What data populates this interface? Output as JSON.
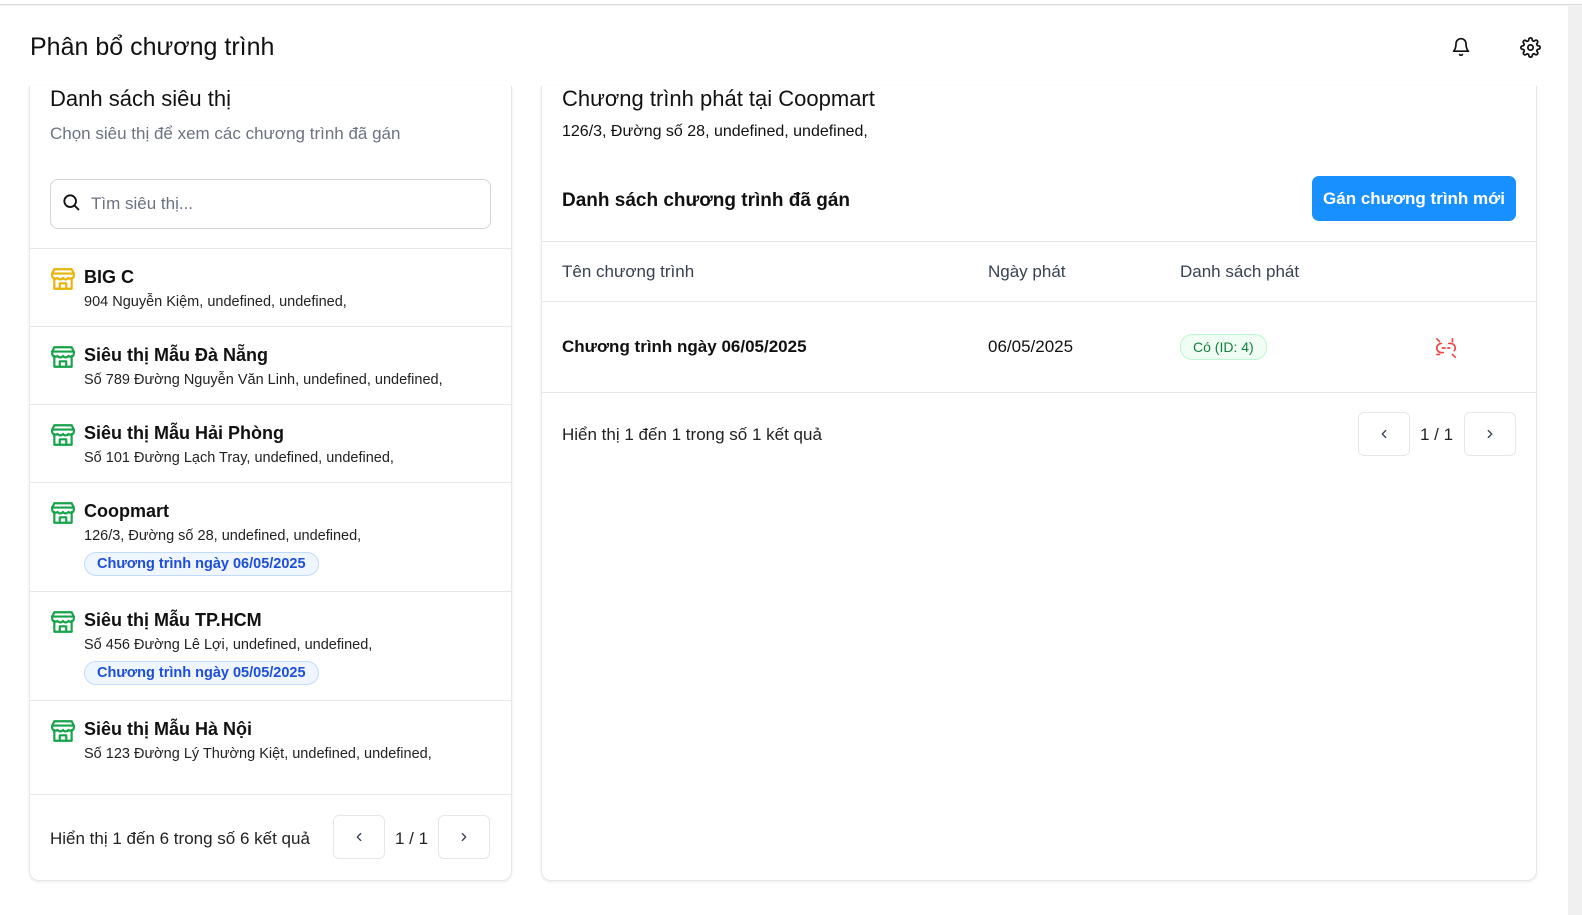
{
  "header": {
    "title": "Phân bổ chương trình",
    "bell_icon": "bell-icon",
    "settings_icon": "gear-icon"
  },
  "left": {
    "title": "Danh sách siêu thị",
    "subtitle": "Chọn siêu thị để xem các chương trình đã gán",
    "search_placeholder": "Tìm siêu thị...",
    "stores": [
      {
        "name": "BIG C",
        "address": "904 Nguyễn Kiệm, undefined, undefined,",
        "tag": "",
        "icon_color": "#eab308"
      },
      {
        "name": "Siêu thị Mẫu Đà Nẵng",
        "address": "Số 789 Đường Nguyễn Văn Linh, undefined, undefined,",
        "tag": "",
        "icon_color": "#16a34a"
      },
      {
        "name": "Siêu thị Mẫu Hải Phòng",
        "address": "Số 101 Đường Lạch Tray, undefined, undefined,",
        "tag": "",
        "icon_color": "#16a34a"
      },
      {
        "name": "Coopmart",
        "address": "126/3, Đường số 28, undefined, undefined,",
        "tag": "Chương trình ngày 06/05/2025",
        "icon_color": "#16a34a"
      },
      {
        "name": "Siêu thị Mẫu TP.HCM",
        "address": "Số 456 Đường Lê Lợi, undefined, undefined,",
        "tag": "Chương trình ngày 05/05/2025",
        "icon_color": "#16a34a"
      },
      {
        "name": "Siêu thị Mẫu Hà Nội",
        "address": "Số 123 Đường Lý Thường Kiệt, undefined, undefined,",
        "tag": "",
        "icon_color": "#16a34a"
      }
    ],
    "pagination": {
      "summary": "Hiển thị 1 đến 6 trong số 6 kết quả",
      "page": "1 / 1"
    }
  },
  "right": {
    "title": "Chương trình phát tại Coopmart",
    "address": "126/3, Đường số 28, undefined, undefined,",
    "list_title": "Danh sách chương trình đã gán",
    "assign_button": "Gán chương trình mới",
    "columns": [
      "Tên chương trình",
      "Ngày phát",
      "Danh sách phát"
    ],
    "rows": [
      {
        "name": "Chương trình ngày 06/05/2025",
        "date": "06/05/2025",
        "playlist": "Có (ID: 4)"
      }
    ],
    "pagination": {
      "summary": "Hiển thị 1 đến 1 trong số 1 kết quả",
      "page": "1 / 1"
    }
  },
  "colors": {
    "primary": "#1890ff",
    "danger": "#ef4444",
    "success": "#15803d"
  }
}
